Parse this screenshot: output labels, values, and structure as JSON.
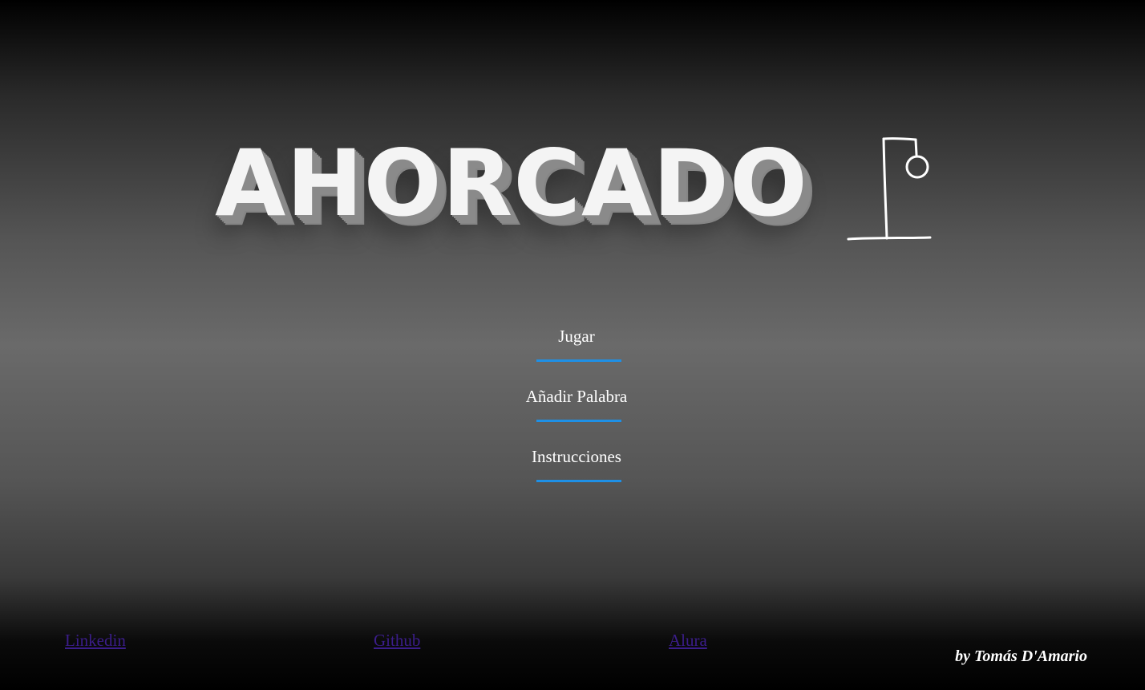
{
  "title": "AHORCADO",
  "menu": {
    "items": [
      {
        "label": "Jugar"
      },
      {
        "label": "Añadir Palabra"
      },
      {
        "label": "Instrucciones"
      }
    ]
  },
  "footer": {
    "links": [
      {
        "label": "Linkedin"
      },
      {
        "label": "Github"
      },
      {
        "label": "Alura"
      }
    ],
    "credit": "by Tomás D'Amario"
  },
  "colors": {
    "accent": "#1e90e6",
    "link": "#3b1d8a",
    "title": "#f4f4f4"
  },
  "icons": {
    "gallows": "gallows-icon"
  }
}
